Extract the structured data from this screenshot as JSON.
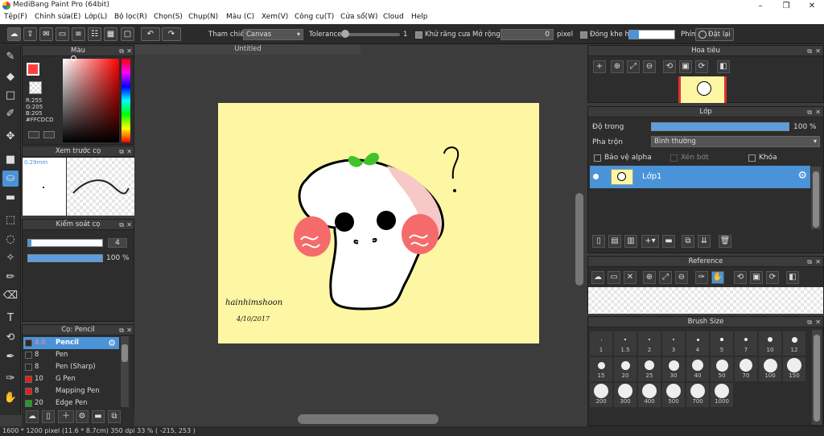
{
  "title": "MediBang Paint Pro (64bit)",
  "menu": [
    "Tệp(F)",
    "Chỉnh sửa(E)",
    "Lớp(L)",
    "Bộ lọc(R)",
    "Chọn(S)",
    "Chụp(N)",
    "Màu (C)",
    "Xem(V)",
    "Công cụ(T)",
    "Cửa sổ(W)",
    "Cloud",
    "Help"
  ],
  "toolbar": {
    "tham_chieu": "Tham chiếu",
    "canvas": "Canvas",
    "tolerance": "Tolerance",
    "tol_val": "1",
    "khu_rang_cua": "Khử răng cưa",
    "mo_rong": "Mở rộng",
    "mo_rong_val": "0",
    "pixel": "pixel",
    "dong_khe_ho": "Đóng khe hở",
    "phim": "Phím",
    "dat_lai": "Đặt lại"
  },
  "mau": {
    "title": "Màu",
    "r": "R:255",
    "g": "G:205",
    "b": "B:205",
    "hex": "#FFCDCD"
  },
  "preview": {
    "title": "Xem trước cọ",
    "size": "0.29mm"
  },
  "brush_ctrl": {
    "title": "Kiểm soát cọ",
    "size": "4",
    "opacity": "100 %",
    "opacity_level": 1.0
  },
  "brushes": {
    "title": "Cọ: Pencil",
    "items": [
      {
        "size": "4.0",
        "name": "Pencil",
        "color": "#2b2b2b",
        "selected": true
      },
      {
        "size": "8",
        "name": "Pen",
        "color": "#2b2b2b"
      },
      {
        "size": "8",
        "name": "Pen (Sharp)",
        "color": "#2b2b2b"
      },
      {
        "size": "10",
        "name": "G Pen",
        "color": "#e02020"
      },
      {
        "size": "8",
        "name": "Mapping Pen",
        "color": "#e02020"
      },
      {
        "size": "20",
        "name": "Edge Pen",
        "color": "#20a020"
      }
    ]
  },
  "doc": {
    "tab": "Untitled",
    "signature": "hainhimshoon",
    "date": "4/10/2017"
  },
  "navigator": {
    "title": "Hoa tiêu"
  },
  "layer": {
    "title": "Lớp",
    "do_trong": "Độ trong",
    "opacity": "100 %",
    "opacity_level": 1.0,
    "pha_tron": "Pha trộn",
    "blend": "Bình thường",
    "bao_ve": "Bảo vệ alpha",
    "xen_bot": "Xén bớt",
    "khoa": "Khóa",
    "layer1": "Lớp1"
  },
  "reference": {
    "title": "Reference"
  },
  "brush_size": {
    "title": "Brush Size",
    "sizes": [
      "1",
      "1.5",
      "2",
      "3",
      "4",
      "5",
      "7",
      "10",
      "12",
      "15",
      "20",
      "25",
      "30",
      "40",
      "50",
      "70",
      "100",
      "150",
      "200",
      "300",
      "400",
      "500",
      "700",
      "1000"
    ]
  },
  "status": {
    "info": "1600 * 1200 pixel   (11.6 * 8.7cm)   350 dpi   33 %   ( -215, 253 )"
  }
}
